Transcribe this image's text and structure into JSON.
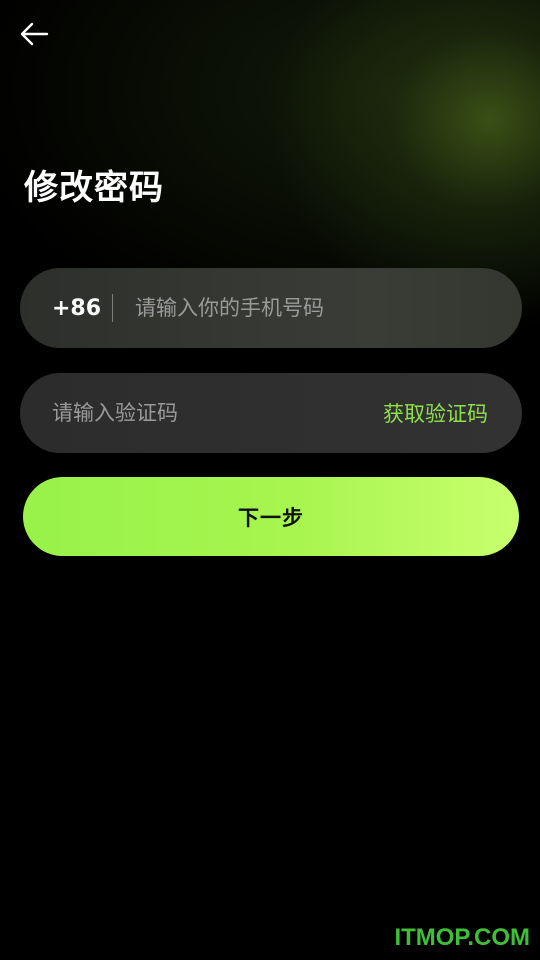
{
  "header": {
    "back_icon": "arrow-left-icon",
    "title": "修改密码"
  },
  "phone_field": {
    "country_code": "+86",
    "value": "",
    "placeholder": "请输入你的手机号码"
  },
  "code_field": {
    "value": "",
    "placeholder": "请输入验证码",
    "get_code_label": "获取验证码"
  },
  "next_button": {
    "label": "下一步"
  },
  "watermark": "ITMOP.COM",
  "colors": {
    "accent": "#97f24a",
    "accent_text": "#8fe04a",
    "background": "#000000",
    "field_bg": "#2d2f2c"
  }
}
